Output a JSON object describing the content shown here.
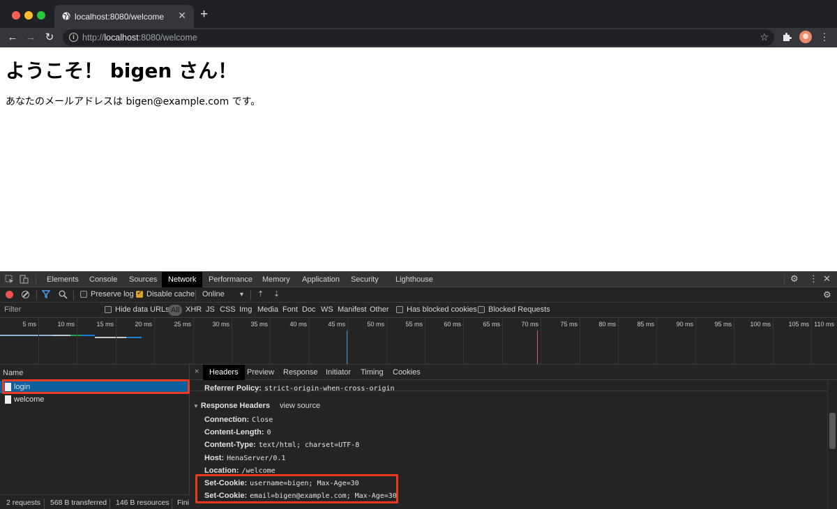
{
  "browser": {
    "tab_title": "localhost:8080/welcome",
    "tab_close": "✕",
    "new_tab": "+",
    "url_prefix": "http://",
    "url_host": "localhost",
    "url_suffix": ":8080/welcome"
  },
  "page": {
    "heading": "ようこそ！ bigen さん！",
    "message": "あなたのメールアドレスは bigen@example.com です。"
  },
  "devtools": {
    "tabs": [
      "Elements",
      "Console",
      "Sources",
      "Network",
      "Performance",
      "Memory",
      "Application",
      "Security",
      "Lighthouse"
    ],
    "active_tab": "Network",
    "toolbar": {
      "preserve_log": "Preserve log",
      "preserve_log_checked": false,
      "disable_cache": "Disable cache",
      "disable_cache_checked": true,
      "throttle": "Online"
    },
    "filter_bar": {
      "placeholder": "Filter",
      "hide_data_urls": "Hide data URLs",
      "all": "All",
      "types": [
        "XHR",
        "JS",
        "CSS",
        "Img",
        "Media",
        "Font",
        "Doc",
        "WS",
        "Manifest",
        "Other"
      ],
      "has_blocked_cookies": "Has blocked cookies",
      "blocked_requests": "Blocked Requests"
    },
    "timeline_ticks": [
      "5 ms",
      "10 ms",
      "15 ms",
      "20 ms",
      "25 ms",
      "30 ms",
      "35 ms",
      "40 ms",
      "45 ms",
      "50 ms",
      "55 ms",
      "60 ms",
      "65 ms",
      "70 ms",
      "75 ms",
      "80 ms",
      "85 ms",
      "90 ms",
      "95 ms",
      "100 ms",
      "105 ms",
      "110 ms"
    ],
    "requests": {
      "column": "Name",
      "rows": [
        {
          "name": "login",
          "selected": true
        },
        {
          "name": "welcome",
          "selected": false
        }
      ]
    },
    "status": {
      "requests": "2 requests",
      "transferred": "568 B transferred",
      "resources": "146 B resources",
      "finish": "Fini"
    },
    "details": {
      "close": "×",
      "tabs": [
        "Headers",
        "Preview",
        "Response",
        "Initiator",
        "Timing",
        "Cookies"
      ],
      "active_tab": "Headers",
      "referrer_key": "Referrer Policy:",
      "referrer_val": "strict-origin-when-cross-origin",
      "response_headers_title": "Response Headers",
      "view_source": "view source",
      "headers": [
        {
          "key": "Connection:",
          "value": "Close"
        },
        {
          "key": "Content-Length:",
          "value": "0"
        },
        {
          "key": "Content-Type:",
          "value": "text/html; charset=UTF-8"
        },
        {
          "key": "Host:",
          "value": "HenaServer/0.1"
        },
        {
          "key": "Location:",
          "value": "/welcome"
        },
        {
          "key": "Set-Cookie:",
          "value": "username=bigen; Max-Age=30"
        },
        {
          "key": "Set-Cookie:",
          "value": "email=bigen@example.com; Max-Age=30"
        }
      ]
    }
  },
  "colors": {
    "highlight": "#ec3a22",
    "selected_row": "#0c5f9a"
  }
}
